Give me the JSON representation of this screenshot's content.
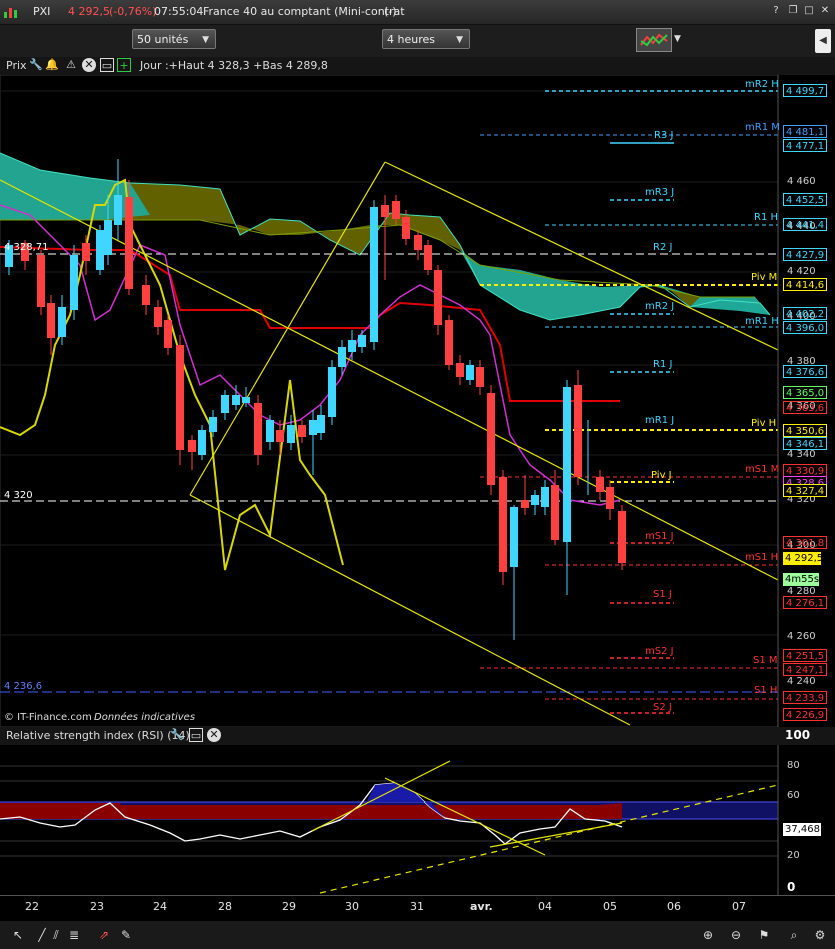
{
  "window": {
    "symbol": "PXI",
    "last_price": "4 292,5",
    "change": "(-0,76%)",
    "time": "07:55:04",
    "instrument": "France 40 au comptant (Mini-contrat",
    "instrument_suffix": "(-)"
  },
  "toolbar": {
    "units_select": "50 unités",
    "period_select": "4 heures"
  },
  "chart_header": {
    "prix_label": "Prix",
    "day_info": "Jour :+Haut 4 328,3 +Bas 4 289,8"
  },
  "price_chart": {
    "left_labels": {
      "level_4328": "4 328,71",
      "level_4320": "4 320",
      "level_4236": "4 236,6"
    },
    "copyright": "© IT-Finance.com",
    "disclaimer": "Données indicatives",
    "countdown": "4m55s",
    "axis_ticks": [
      "4 460",
      "4 440",
      "4 420",
      "4 400",
      "4 380",
      "4 360",
      "4 340",
      "4 320",
      "4 300",
      "4 280",
      "4 260",
      "4 240"
    ],
    "level_labels": {
      "mR2_H": "mR2 H",
      "R3_J": "R3 J",
      "mR1_M": "mR1 M",
      "mR3_J": "mR3 J",
      "R1_H": "R1 H",
      "R2_J": "R2 J",
      "Piv_M": "Piv M",
      "mR2_J": "mR2 J",
      "mR1_H": "mR1 H",
      "R1_J": "R1 J",
      "mR1_J": "mR1 J",
      "Piv_H": "Piv H",
      "mS1_M": "mS1 M",
      "Piv_J": "Piv J",
      "mS1_J": "mS1 J",
      "mS1_H": "mS1 H",
      "S1_J": "S1 J",
      "mS2_J": "mS2 J",
      "S1_M": "S1 M",
      "S1_H": "S1 H",
      "S2_J": "S2 J"
    },
    "price_tags": {
      "t4499": "4 499,7",
      "t4481": "4 481,1",
      "t4477": "4 477,1",
      "t4452": "4 452,5",
      "t4441": "4 441,4",
      "t4427": "4 427,9",
      "t4414": "4 414,6",
      "t4402": "4 402,2",
      "t4396": "4 396,0",
      "t4376": "4 376,6",
      "t4365": "4 365,0",
      "t4363": "4 363,6",
      "t4350": "4 350,6",
      "t4346": "4 346,1",
      "t4330": "4 330,9",
      "t4328": "4 328,6",
      "t4327": "4 327,4",
      "t4301": "4 301,8",
      "t4292": "4 292,5",
      "t4276": "4 276,1",
      "t4251": "4 251,5",
      "t4247": "4 247,1",
      "t4233": "4 233,9",
      "t4226": "4 226,9"
    }
  },
  "rsi_panel": {
    "title": "Relative strength index (RSI) (14)",
    "axis_ticks": [
      "100",
      "80",
      "60",
      "40",
      "20",
      "0"
    ],
    "current_value": "37,468"
  },
  "x_axis": {
    "labels": [
      "22",
      "23",
      "24",
      "28",
      "29",
      "30",
      "31",
      "avr.",
      "04",
      "05",
      "06",
      "07"
    ]
  },
  "colors": {
    "up_candle": "#3fd6ff",
    "down_candle": "#ff4040",
    "trendline": "#e6e600",
    "cloud_green": "#20a090",
    "cloud_olive": "#6b6b00",
    "kijun": "#e00000",
    "tenkan": "#c030c0",
    "rsi_fill": "#8a0000",
    "rsi_blue": "#1a1aa8"
  }
}
